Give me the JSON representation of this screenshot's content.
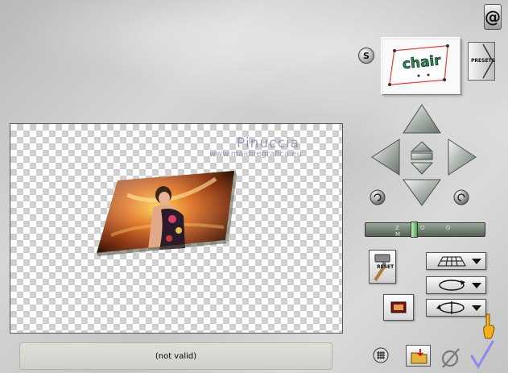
{
  "status": {
    "text": "(not valid)"
  },
  "watermark": {
    "line1": "Pinuccia",
    "line2": "www.maidiregrafica.eu"
  },
  "thumbnail": {
    "text": "chair"
  },
  "buttons": {
    "logo_glyph": "@",
    "s_label": "S",
    "presets_label": "PRESETS",
    "reset_label": "RESET"
  },
  "zoom": {
    "label": "Z O O M",
    "level": 0.4
  },
  "icons": {
    "logo": "eye-candy-logo-icon",
    "up": "arrow-up-icon",
    "down": "arrow-down-icon",
    "left": "arrow-left-icon",
    "right": "arrow-right-icon",
    "rotate_left": "rotate-left-icon",
    "rotate_right": "rotate-right-icon",
    "grid": "grid-icon",
    "folder": "folder-icon",
    "cancel": "cancel-icon",
    "ok": "checkmark-icon",
    "pointer": "hand-pointer-icon"
  },
  "colors": {
    "background": "#cfcfcf",
    "status_bg": "#d8d9d2",
    "checker": "#cfcfcf",
    "zoom_thumb": "#4fa04f",
    "ok_check": "#8a8af0"
  }
}
